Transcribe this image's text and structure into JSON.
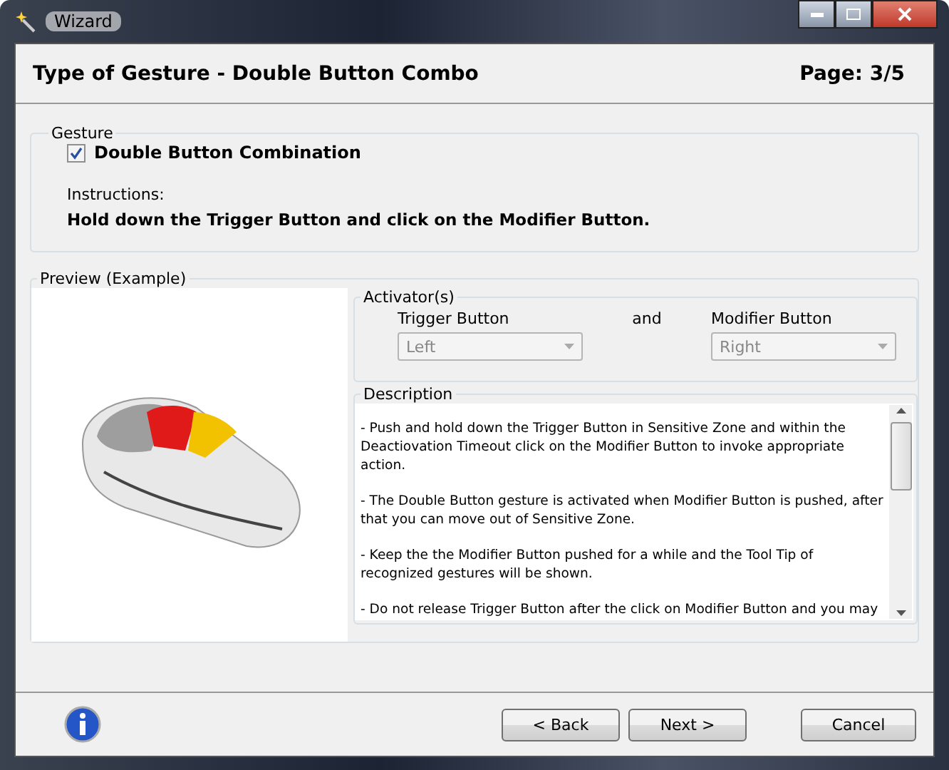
{
  "window": {
    "title": "Wizard"
  },
  "header": {
    "title": "Type of Gesture - Double Button Combo",
    "page": "Page: 3/5"
  },
  "gesture": {
    "label": "Gesture",
    "checkbox": {
      "label": "Double Button Combination",
      "checked": true
    },
    "instructions_label": "Instructions:",
    "instructions": "Hold down the Trigger Button and click on the Modifier Button."
  },
  "preview": {
    "label": "Preview (Example)"
  },
  "activators": {
    "label": "Activator(s)",
    "joiner": "and",
    "selects": [
      {
        "label": "Trigger Button",
        "value": "Left",
        "disabled": true
      },
      {
        "label": "Modifier Button",
        "value": "Right",
        "disabled": true
      }
    ]
  },
  "description": {
    "label": "Description",
    "paragraphs": [
      "- Push and hold down the Trigger Button in Sensitive Zone and within the Deactiovation Timeout click on the Modifier Button to invoke appropriate action.",
      "- The Double Button gesture is activated when Modifier Button is pushed, after that you can move out of Sensitive Zone.",
      "- Keep the the Modifier Button pushed for a while and the Tool Tip of recognized gestures will be shown.",
      "- Do not release Trigger Button after the click on Modifier Button and you may"
    ]
  },
  "buttons": [
    {
      "label": "< Back",
      "kind": "nav"
    },
    {
      "label": "Next >",
      "kind": "nav"
    },
    {
      "label": "Cancel",
      "kind": "cancel"
    }
  ]
}
